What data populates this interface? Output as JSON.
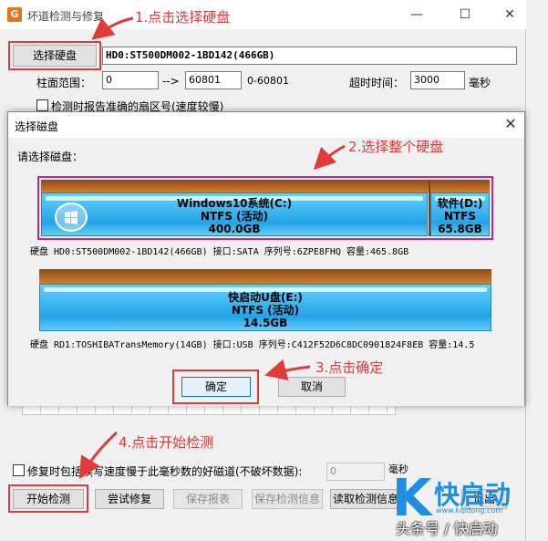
{
  "window": {
    "title": "坏道检测与修复",
    "minimize": "—",
    "maximize": "☐",
    "close": "✕"
  },
  "top": {
    "select_disk_btn": "选择硬盘",
    "disk_id": "HD0:ST500DM002-1BD142(466GB)",
    "cyl_label": "柱面范围：",
    "cyl_from": "0",
    "cyl_arrow": "-->",
    "cyl_to": "60801",
    "cyl_range": "0-60801",
    "timeout_label": "超时时间：",
    "timeout_value": "3000",
    "timeout_unit": "毫秒",
    "report_checkbox": "检测时报告准确的扇区号(速度较慢)"
  },
  "dialog": {
    "title": "选择磁盘",
    "close": "✕",
    "prompt": "请选择磁盘：",
    "disk1": {
      "p1": {
        "name": "Windows10系统(C:)",
        "fs": "NTFS (活动)",
        "size": "400.0GB"
      },
      "p2": {
        "name": "软件(D:)",
        "fs": "NTFS",
        "size": "65.8GB"
      },
      "info": "硬盘 HD0:ST500DM002-1BD142(466GB)    接口:SATA  序列号:6ZPE8FHQ   容量:465.8GB"
    },
    "disk2": {
      "p1": {
        "name": "快启动U盘(E:)",
        "fs": "NTFS (活动)",
        "size": "14.5GB"
      },
      "info": "硬盘 RD1:TOSHIBATransMemory(14GB)    接口:USB  序列号:C412F52D6C8DC0901824F8EB  容量:14.5"
    },
    "ok": "确定",
    "cancel": "取消"
  },
  "bottom": {
    "repair_checkbox": "修复时包括读写速度慢于此毫秒数的好磁道(不破坏数据):",
    "ms_value": "0",
    "ms_unit": "毫秒",
    "start_btn": "开始检测",
    "try_repair_btn": "尝试修复",
    "save_report_btn": "保存报表",
    "save_info_btn": "保存检测信息",
    "read_info_btn": "读取检测信息",
    "exit_btn": "退出"
  },
  "annotations": {
    "a1": "1.点击选择硬盘",
    "a2": "2.选择整个硬盘",
    "a3": "3.点击确定",
    "a4": "4.点击开始检测"
  },
  "watermark": {
    "brand": "快启动",
    "url": "www.kqidong.com",
    "caption": "头条号 / 快启动",
    "logo_letter": "K"
  },
  "colors": {
    "annotation": "#e03a3a",
    "partition": "#3fb7f0",
    "disk_bar": "#b86a24",
    "brand": "#1f8ee0"
  }
}
